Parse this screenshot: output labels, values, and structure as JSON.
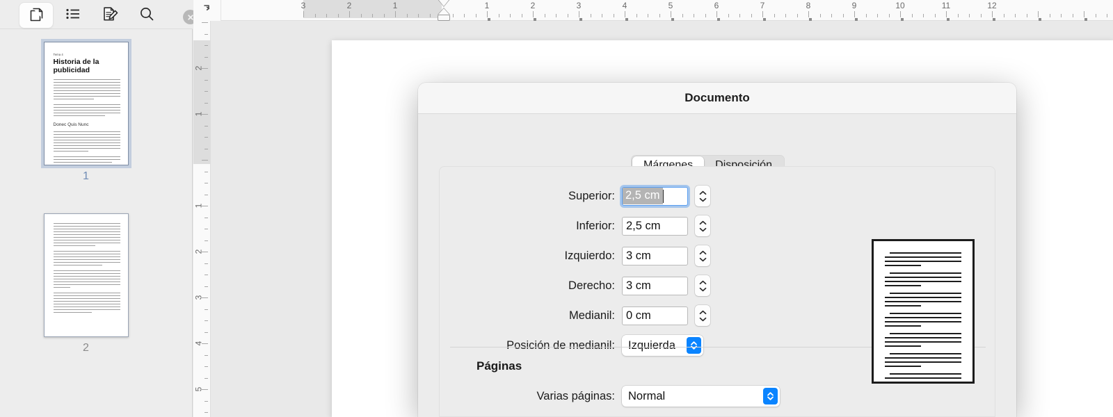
{
  "sidebar": {
    "tabs": [
      {
        "name": "pages",
        "icon": "pages-icon",
        "selected": true
      },
      {
        "name": "outline",
        "icon": "list-icon",
        "selected": false
      },
      {
        "name": "review",
        "icon": "document-edit-icon",
        "selected": false
      },
      {
        "name": "search",
        "icon": "search-icon",
        "selected": false
      }
    ],
    "close_icon": "close-icon",
    "thumbnails": [
      {
        "number": "1",
        "selected": true,
        "kicker": "Tema 4",
        "title": "Historia de la publicidad",
        "subheading": "Donec Quis Nunc"
      },
      {
        "number": "2",
        "selected": false
      }
    ]
  },
  "ruler": {
    "horizontal_numbers": [
      "3",
      "2",
      "1",
      "1",
      "2",
      "3",
      "4",
      "5",
      "6",
      "7",
      "8",
      "9",
      "10",
      "11",
      "12"
    ],
    "vertical_numbers": [
      "2",
      "1",
      "1",
      "2",
      "3",
      "4",
      "5"
    ],
    "tab_icon": "tab-stop-icon",
    "unit": "cm"
  },
  "dialog": {
    "title": "Documento",
    "tabs": [
      {
        "label": "Márgenes",
        "active": true
      },
      {
        "label": "Disposición",
        "active": false
      }
    ],
    "margins": [
      {
        "label": "Superior:",
        "value": "2,5 cm",
        "focused": true
      },
      {
        "label": "Inferior:",
        "value": "2,5 cm",
        "focused": false
      },
      {
        "label": "Izquierdo:",
        "value": "3 cm",
        "focused": false
      },
      {
        "label": "Derecho:",
        "value": "3 cm",
        "focused": false
      },
      {
        "label": "Medianil:",
        "value": "0 cm",
        "focused": false
      }
    ],
    "gutter_position": {
      "label": "Posición de medianil:",
      "value": "Izquierda"
    },
    "pages_section": {
      "heading": "Páginas",
      "multiple_pages": {
        "label": "Varias páginas:",
        "value": "Normal"
      }
    },
    "preview_name": "page-preview"
  },
  "colors": {
    "accent": "#0a84ff",
    "focus_ring": "#5a9ef0",
    "selection": "#b4b4b4",
    "page_number_active": "#6f8bb5",
    "page_number_inactive": "#8a8a8a",
    "window_bg": "#ececec",
    "canvas_bg": "#e9e9e9"
  }
}
